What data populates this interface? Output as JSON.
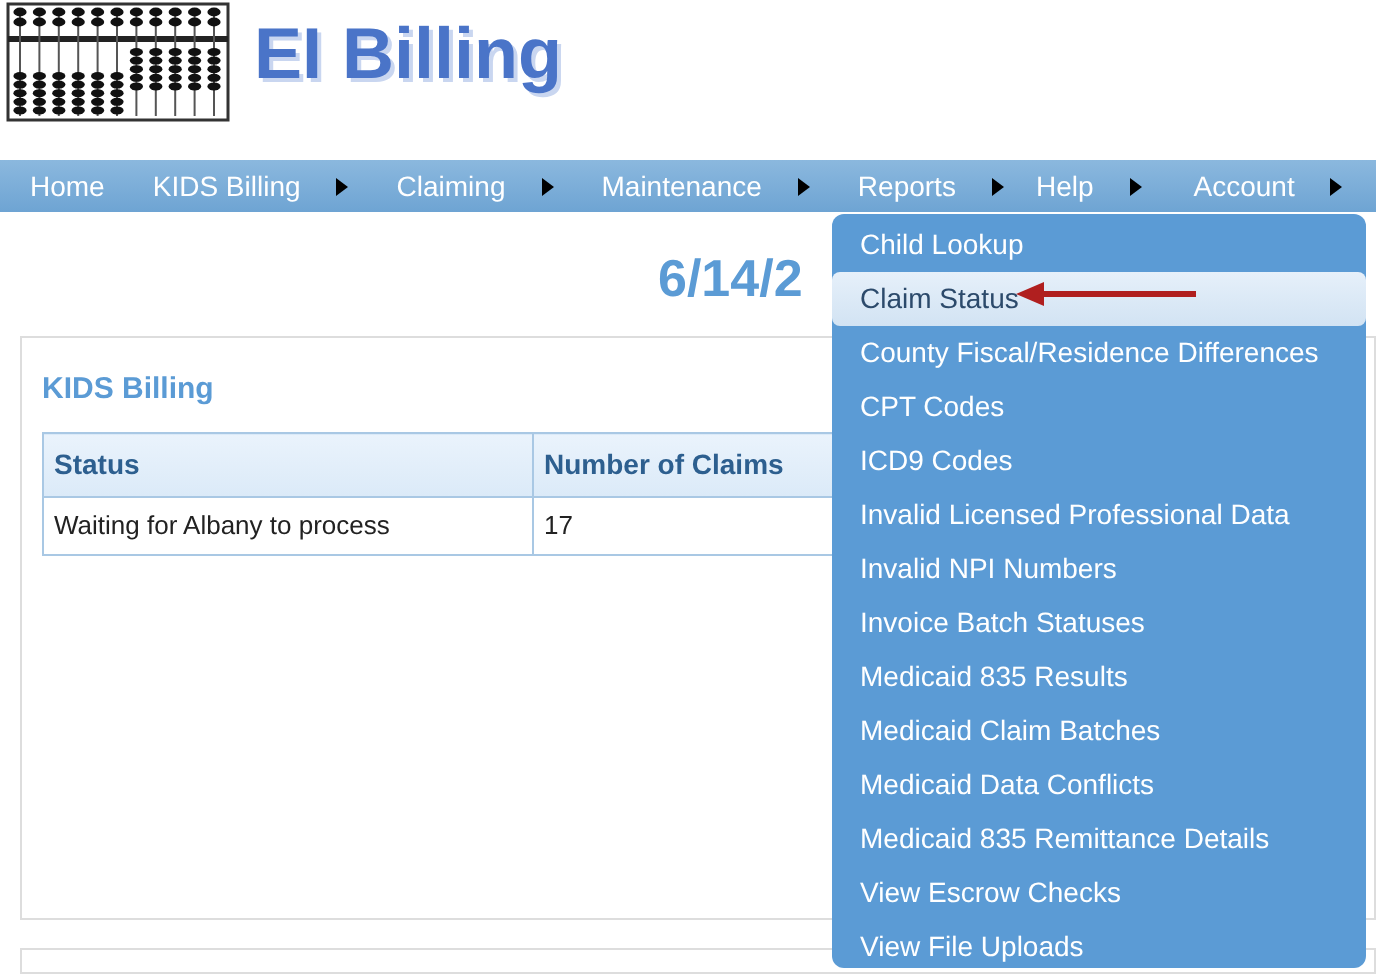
{
  "header": {
    "title": "EI Billing"
  },
  "nav": [
    {
      "label": "Home",
      "kind": "link"
    },
    {
      "label": "KIDS Billing",
      "kind": "submenu"
    },
    {
      "label": "Claiming",
      "kind": "submenu"
    },
    {
      "label": "Maintenance",
      "kind": "submenu"
    },
    {
      "label": "Reports",
      "kind": "submenu"
    },
    {
      "label": "Help",
      "kind": "submenu"
    },
    {
      "label": "Account",
      "kind": "submenu"
    }
  ],
  "page_heading": "6/14/2",
  "card": {
    "title": "KIDS Billing",
    "table": {
      "columns": [
        "Status",
        "Number of Claims"
      ],
      "rows": [
        [
          "Waiting for Albany to process",
          "17"
        ]
      ]
    }
  },
  "reports_menu": [
    {
      "label": "Child Lookup",
      "selected": false
    },
    {
      "label": "Claim Status",
      "selected": true
    },
    {
      "label": "County Fiscal/Residence Differences",
      "selected": false
    },
    {
      "label": "CPT Codes",
      "selected": false
    },
    {
      "label": "ICD9 Codes",
      "selected": false
    },
    {
      "label": "Invalid Licensed Professional Data",
      "selected": false
    },
    {
      "label": "Invalid NPI Numbers",
      "selected": false
    },
    {
      "label": "Invoice Batch Statuses",
      "selected": false
    },
    {
      "label": "Medicaid 835 Results",
      "selected": false
    },
    {
      "label": "Medicaid Claim Batches",
      "selected": false
    },
    {
      "label": "Medicaid Data Conflicts",
      "selected": false
    },
    {
      "label": "Medicaid 835 Remittance Details",
      "selected": false
    },
    {
      "label": "View Escrow Checks",
      "selected": false
    },
    {
      "label": "View File Uploads",
      "selected": false
    }
  ]
}
